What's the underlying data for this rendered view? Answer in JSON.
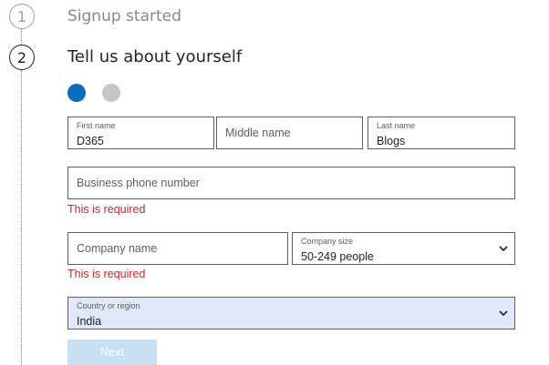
{
  "steps": [
    {
      "number": "1",
      "title": "Signup started"
    },
    {
      "number": "2",
      "title": "Tell us about yourself"
    }
  ],
  "progress": {
    "current_page": 1,
    "total_pages": 2
  },
  "colors": {
    "accent": "#0f6cbd",
    "inactive_dot": "#c8c6c4",
    "error": "#c4262e",
    "selected_field_bg": "#dfe9fb",
    "button_disabled_bg": "#c7e0f4"
  },
  "form": {
    "first_name": {
      "label": "First name",
      "value": "D365"
    },
    "middle_name": {
      "placeholder": "Middle name"
    },
    "last_name": {
      "label": "Last name",
      "value": "Blogs"
    },
    "business_phone": {
      "placeholder": "Business phone number",
      "error": "This is required"
    },
    "company_name": {
      "placeholder": "Company name",
      "error": "This is required"
    },
    "company_size": {
      "label": "Company size",
      "value": "50-249 people",
      "icon": "chevron-down-icon"
    },
    "country": {
      "label": "Country or region",
      "value": "India",
      "icon": "chevron-down-icon"
    }
  },
  "buttons": {
    "next": "Next"
  }
}
